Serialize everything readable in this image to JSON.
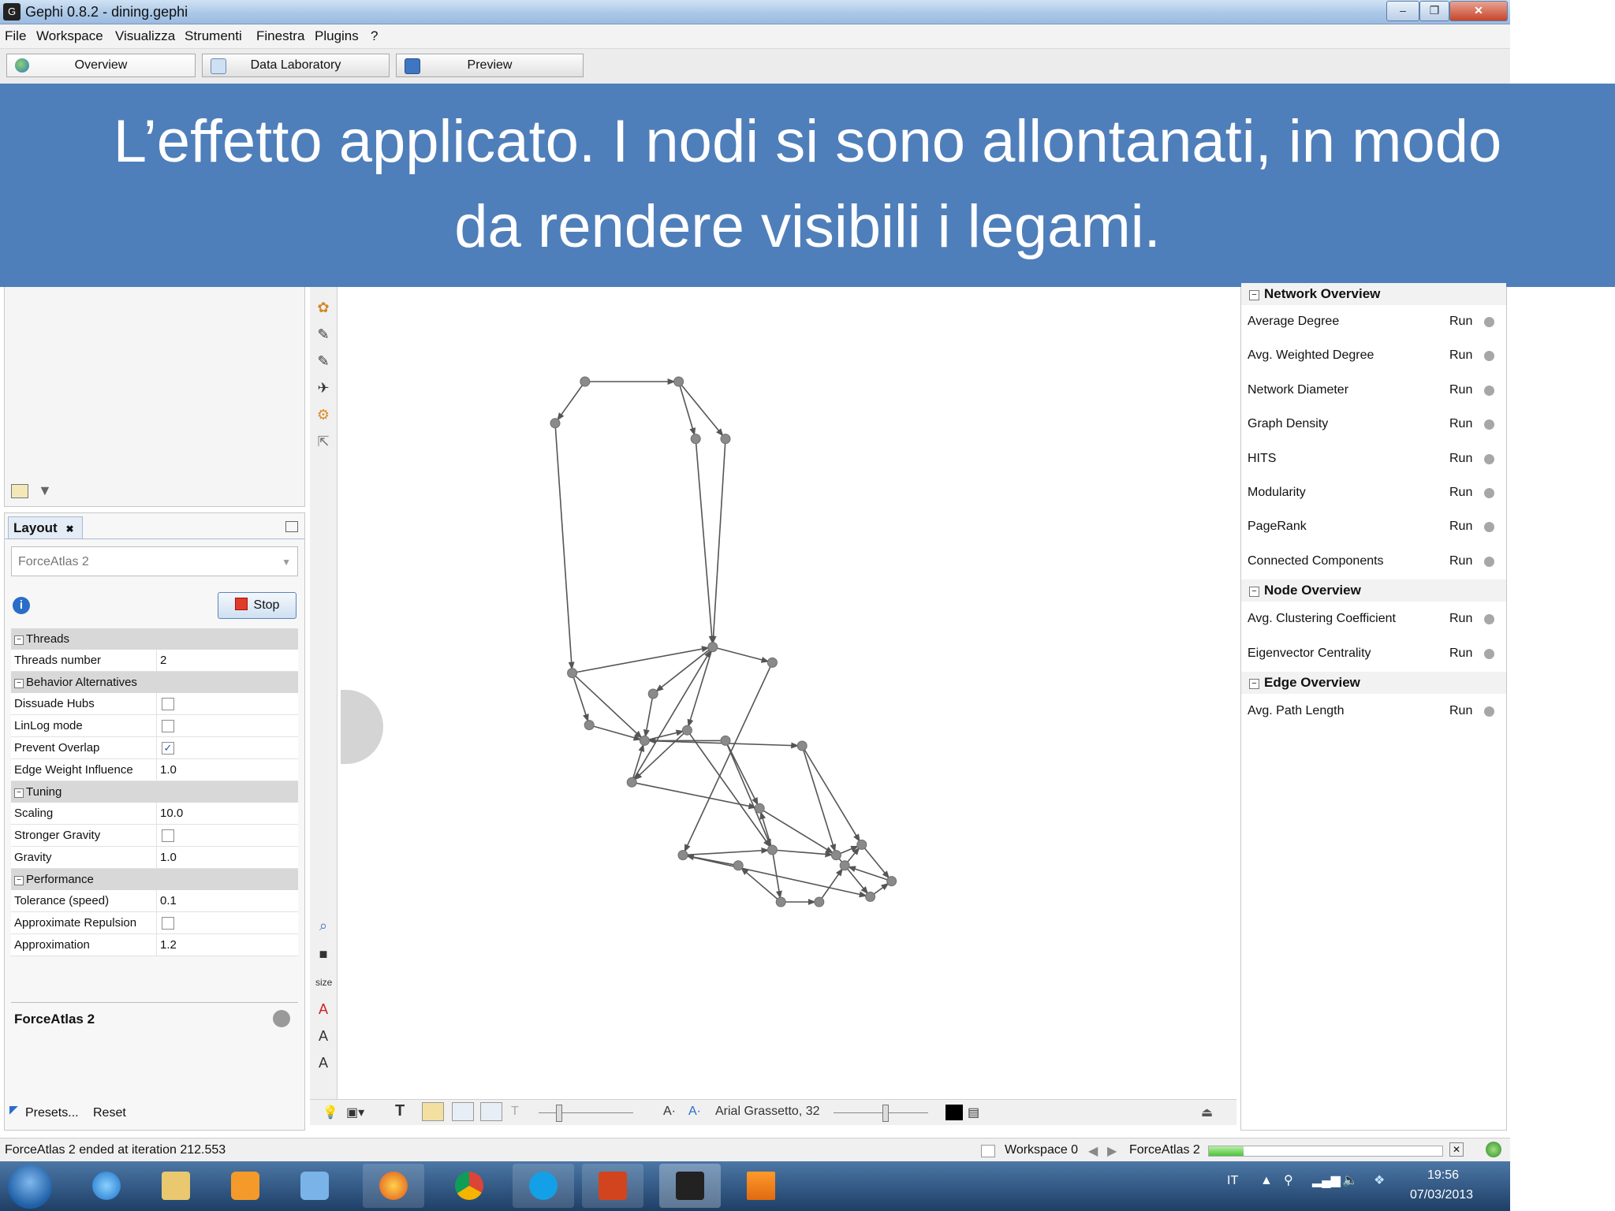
{
  "window": {
    "title": "Gephi 0.8.2 - dining.gephi"
  },
  "menu": [
    "File",
    "Workspace",
    "Visualizza",
    "Strumenti",
    "Finestra",
    "Plugins",
    "?"
  ],
  "tabs": {
    "overview": "Overview",
    "data_laboratory": "Data Laboratory",
    "preview": "Preview"
  },
  "banner": {
    "line1": "L’effetto applicato. I nodi si sono allontanati, in modo",
    "line2": "da rendere visibili i legami."
  },
  "layout": {
    "tab_label": "Layout",
    "algorithm": "ForceAtlas 2",
    "stop_label": "Stop",
    "categories": {
      "threads": "Threads",
      "behavior": "Behavior Alternatives",
      "tuning": "Tuning",
      "performance": "Performance"
    },
    "props": {
      "threads_number": {
        "label": "Threads number",
        "value": "2"
      },
      "dissuade_hubs": {
        "label": "Dissuade Hubs"
      },
      "linlog": {
        "label": "LinLog mode"
      },
      "prevent_overlap": {
        "label": "Prevent Overlap",
        "check": "✓"
      },
      "edge_weight": {
        "label": "Edge Weight Influence",
        "value": "1.0"
      },
      "scaling": {
        "label": "Scaling",
        "value": "10.0"
      },
      "stronger_gravity": {
        "label": "Stronger Gravity"
      },
      "gravity": {
        "label": "Gravity",
        "value": "1.0"
      },
      "tolerance": {
        "label": "Tolerance (speed)",
        "value": "0.1"
      },
      "approx_repulsion": {
        "label": "Approximate Repulsion"
      },
      "approximation": {
        "label": "Approximation",
        "value": "1.2"
      }
    },
    "desc_title": "ForceAtlas 2",
    "presets": "Presets...",
    "reset": "Reset"
  },
  "vtoolbar": {
    "size_label": "size"
  },
  "btoolbar": {
    "font_label": "Arial Grassetto, 32",
    "font_icon1": "A·",
    "font_icon2": "A·",
    "text_icon": "T"
  },
  "statistics": {
    "run_label": "Run",
    "network_overview": "Network Overview",
    "node_overview": "Node Overview",
    "edge_overview": "Edge Overview",
    "network": [
      "Average Degree",
      "Avg. Weighted Degree",
      "Network Diameter",
      "Graph Density",
      "HITS",
      "Modularity",
      "PageRank",
      "Connected Components"
    ],
    "node": [
      "Avg. Clustering Coefficient",
      "Eigenvector Centrality"
    ],
    "edge": [
      "Avg. Path Length"
    ]
  },
  "status": {
    "message": "ForceAtlas 2 ended at iteration 212.553",
    "workspace": "Workspace 0",
    "algorithm": "ForceAtlas 2",
    "progress": 0.15
  },
  "taskbar": {
    "lang": "IT",
    "time": "19:56",
    "date": "07/03/2013"
  },
  "colors": {
    "banner": "#4f7fba",
    "edge": "#555555",
    "node": "#8a8a8a"
  },
  "graph": {
    "nodes": [
      [
        0.0,
        0.92
      ],
      [
        0.07,
        1.0
      ],
      [
        0.29,
        1.0
      ],
      [
        0.33,
        0.89
      ],
      [
        0.4,
        0.89
      ],
      [
        0.04,
        0.44
      ],
      [
        0.37,
        0.49
      ],
      [
        0.51,
        0.46
      ],
      [
        0.23,
        0.4
      ],
      [
        0.08,
        0.34
      ],
      [
        0.21,
        0.31
      ],
      [
        0.31,
        0.33
      ],
      [
        0.4,
        0.31
      ],
      [
        0.18,
        0.23
      ],
      [
        0.58,
        0.3
      ],
      [
        0.48,
        0.18
      ],
      [
        0.3,
        0.09
      ],
      [
        0.51,
        0.1
      ],
      [
        0.66,
        0.09
      ],
      [
        0.74,
        0.01
      ],
      [
        0.79,
        0.04
      ],
      [
        0.53,
        0.0
      ],
      [
        0.43,
        0.07
      ],
      [
        0.62,
        0.0
      ],
      [
        0.68,
        0.07
      ],
      [
        0.72,
        0.11
      ]
    ],
    "edges": [
      [
        1,
        0
      ],
      [
        0,
        5
      ],
      [
        1,
        2
      ],
      [
        2,
        3
      ],
      [
        2,
        4
      ],
      [
        3,
        6
      ],
      [
        4,
        6
      ],
      [
        5,
        6
      ],
      [
        5,
        10
      ],
      [
        6,
        7
      ],
      [
        6,
        11
      ],
      [
        5,
        9
      ],
      [
        9,
        10
      ],
      [
        10,
        11
      ],
      [
        6,
        8
      ],
      [
        8,
        10
      ],
      [
        7,
        16
      ],
      [
        10,
        14
      ],
      [
        13,
        10
      ],
      [
        12,
        10
      ],
      [
        11,
        17
      ],
      [
        12,
        15
      ],
      [
        14,
        18
      ],
      [
        15,
        18
      ],
      [
        16,
        17
      ],
      [
        17,
        18
      ],
      [
        12,
        17
      ],
      [
        11,
        13
      ],
      [
        17,
        15
      ],
      [
        13,
        15
      ],
      [
        17,
        21
      ],
      [
        21,
        22
      ],
      [
        22,
        16
      ],
      [
        21,
        23
      ],
      [
        23,
        24
      ],
      [
        20,
        24
      ],
      [
        18,
        19
      ],
      [
        19,
        20
      ],
      [
        25,
        20
      ],
      [
        14,
        25
      ],
      [
        24,
        25
      ],
      [
        16,
        19
      ],
      [
        18,
        25
      ],
      [
        13,
        6
      ]
    ]
  }
}
